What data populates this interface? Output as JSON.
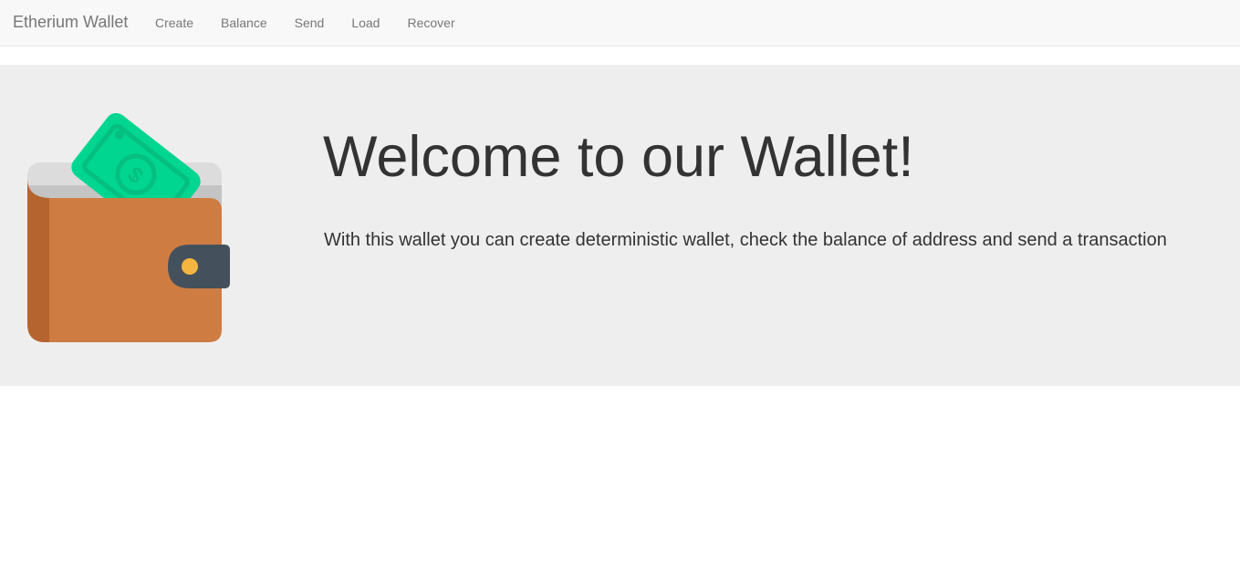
{
  "navbar": {
    "brand": "Etherium Wallet",
    "links": [
      "Create",
      "Balance",
      "Send",
      "Load",
      "Recover"
    ]
  },
  "jumbotron": {
    "headline": "Welcome to our Wallet!",
    "lead": "With this wallet you can create deterministic wallet, check the balance of address and send a transaction"
  },
  "illustration": {
    "icon": "wallet-with-cash-icon",
    "colors": {
      "wallet": "#cf7c43",
      "wallet_side": "#b5642f",
      "cash": "#00d68f",
      "clasp": "#44515c",
      "button": "#f5b53f"
    }
  }
}
